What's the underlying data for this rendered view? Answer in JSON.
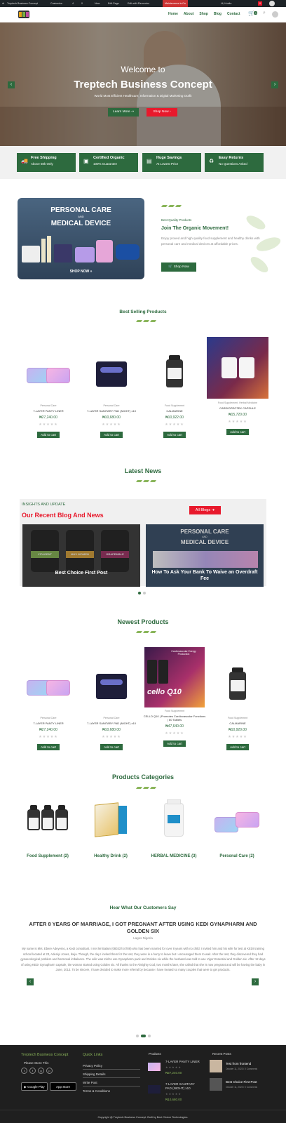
{
  "adminbar": {
    "site": "Treptech Business Concept",
    "customize": "Customize",
    "count1": "4",
    "count2": "0",
    "new": "New",
    "edit_page": "Edit Page",
    "elementor": "Edit with Elementor",
    "maintenance": "Maintenance is On",
    "user": "Hi, Kosito",
    "cart_count": "0"
  },
  "nav": {
    "items": [
      "Home",
      "About",
      "Shop",
      "Blog",
      "Contact"
    ],
    "cart_count": "0"
  },
  "hero": {
    "title": "Welcome to",
    "subtitle": "Treptech Business Concept",
    "tagline": "World Most Efficient Healthcare, Information & Digital Marketing Outfit",
    "btn_learn": "Learn More",
    "btn_shop": "Shop Now"
  },
  "features": [
    {
      "icon": "truck-icon",
      "title": "Free Shipping",
      "sub": "Above 50k Only"
    },
    {
      "icon": "certificate-icon",
      "title": "Certified Organic",
      "sub": "100% Guarantee"
    },
    {
      "icon": "money-icon",
      "title": "Huge Savings",
      "sub": "At Lowest Price"
    },
    {
      "icon": "return-icon",
      "title": "Easy Returns",
      "sub": "No Questions Asked"
    }
  ],
  "promo": {
    "banner_line1": "PERSONAL CARE",
    "banner_and": "AND",
    "banner_line2": "MEDICAL DEVICE",
    "banner_btn": "SHOP NOW »",
    "kicker": "Best Quality Products",
    "title": "Join The Organic Movement!",
    "text": "Enjoy proved and high quality food supplement and healthy drinks with personal care and medical devices at affordable prices.",
    "btn": "Shop Now"
  },
  "best_selling": {
    "title": "Best Selling Products",
    "products": [
      {
        "cat": "Personal Care",
        "name": "7-LAYER PANTY LINER",
        "price": "₦27,240.00",
        "btn": "Add to cart"
      },
      {
        "cat": "Personal Care",
        "name": "7-LAYER SANITARY PAD (NIGHT) x10",
        "price": "₦10,680.00",
        "btn": "Add to cart"
      },
      {
        "cat": "Food Supplement",
        "name": "CALMARINE",
        "price": "₦10,922.00",
        "btn": "Add to cart"
      },
      {
        "cat": "Food Supplement, Herbal Medicine",
        "name": "CARDIOPROTEK CAPSULE",
        "price": "₦15,720.00",
        "btn": "Add to cart"
      }
    ]
  },
  "news": {
    "title": "Latest News",
    "kicker": "INSIGHTS AND UPDATE",
    "heading": "Our Recent Blog And News",
    "btn": "All Blogs",
    "card1_caption": "Best Choice First Post",
    "card1_labels": [
      "VITAGENT",
      "M&V WOMEN",
      "GRAPEMIN-E"
    ],
    "card2_line1": "PERSONAL CARE",
    "card2_and": "AND",
    "card2_line2": "MEDICAL DEVICE",
    "card2_caption": "How To Ask Your Bank To Waive an Overdraft Fee"
  },
  "newest": {
    "title": "Newest Products",
    "products": [
      {
        "cat": "Personal Care",
        "name": "7-LAYER PANTY LINER",
        "price": "₦27,240.00",
        "btn": "Add to cart"
      },
      {
        "cat": "Personal Care",
        "name": "7-LAYER SANITARY PAD (NIGHT) x10",
        "price": "₦10,680.00",
        "btn": "Add to cart"
      },
      {
        "cat": "Food Supplement",
        "name": "CELLO Q10 | Promotes Cardiovascular Functions | 60 Tablets",
        "price": "₦47,640.00",
        "btn": "Add to cart"
      },
      {
        "cat": "Food Supplement",
        "name": "CALMARINE",
        "price": "₦10,920.00",
        "btn": "Add to cart"
      }
    ],
    "banner_text": "Cardiovascular Energy Production",
    "banner_brand": "cello Q10"
  },
  "categories": {
    "title": "Products Categories",
    "items": [
      "Food Supplement (2)",
      "Healthy Drink (2)",
      "HERBAL MEDICINE (3)",
      "Personal Care (2)"
    ]
  },
  "testimonial": {
    "title": "Hear What Our Customers Say",
    "headline": "AFTER 8 YEARS OF MARRIAGE, I GOT PREGNANT AFTER USING KEDI GYNAPHARM AND GOLDEN SIX",
    "location": "Lagos Nigeria",
    "text": "My name is Mrs. Ebere Adeyemo, a Kedi consultant. I met Mr Balam (08033744789) who has been married for over 8 years with no child. I invited him and his wife for test at KEDI training school located at 23, Adeniyi Jones, Ikeja. Though, the day I invited them for the test, they were in a hurry to leave but I encouraged them to wait. After the test, they discovered they had gynaecological problem and hormonal imbalance. The wife was told to use Gynapharm pack and Golden six while the husband was told to use Vigor Essential and Golden six. After 12 days of using KEDI Gynapharm capsule, the woman started using Golden six. All thanks to the Almighty God, two months later, she called that she is now pregnant and will be having the baby in June, 2013. To be sincere, I have decided to make more referral by because I have treated so many couples that were to get products."
  },
  "footer": {
    "brand": "Treptech Business Concept",
    "store_label": "Please Store This",
    "google_play": "Google Play",
    "app_store": "App Store",
    "links_title": "Quick Links",
    "links": [
      "Privacy Policy",
      "Shipping Details",
      "Write Post",
      "Terms & Conditions"
    ],
    "products_title": "Products",
    "products": [
      {
        "name": "7-LAYER PANTY LINER",
        "price": "₦27,240.00"
      },
      {
        "name": "7-LAYER SANITARY PAD (NIGHT) x10",
        "price": "₦10,680.00"
      }
    ],
    "recent_title": "Recent Posts",
    "posts": [
      {
        "title": "Test from frontend",
        "meta": "October 11, 2023 / 0 Comments"
      },
      {
        "title": "Best Choice First Post",
        "meta": "October 11, 2023 / 0 Comments"
      }
    ],
    "copyright": "Copyright @ Treptech Business Concept. Built by Best Choice Technologies."
  },
  "colors": {
    "brand_green": "#2d6a3e",
    "accent_red": "#e8192c",
    "leaf_green": "#8ab55a",
    "footer_bg": "#1f1f1f"
  }
}
